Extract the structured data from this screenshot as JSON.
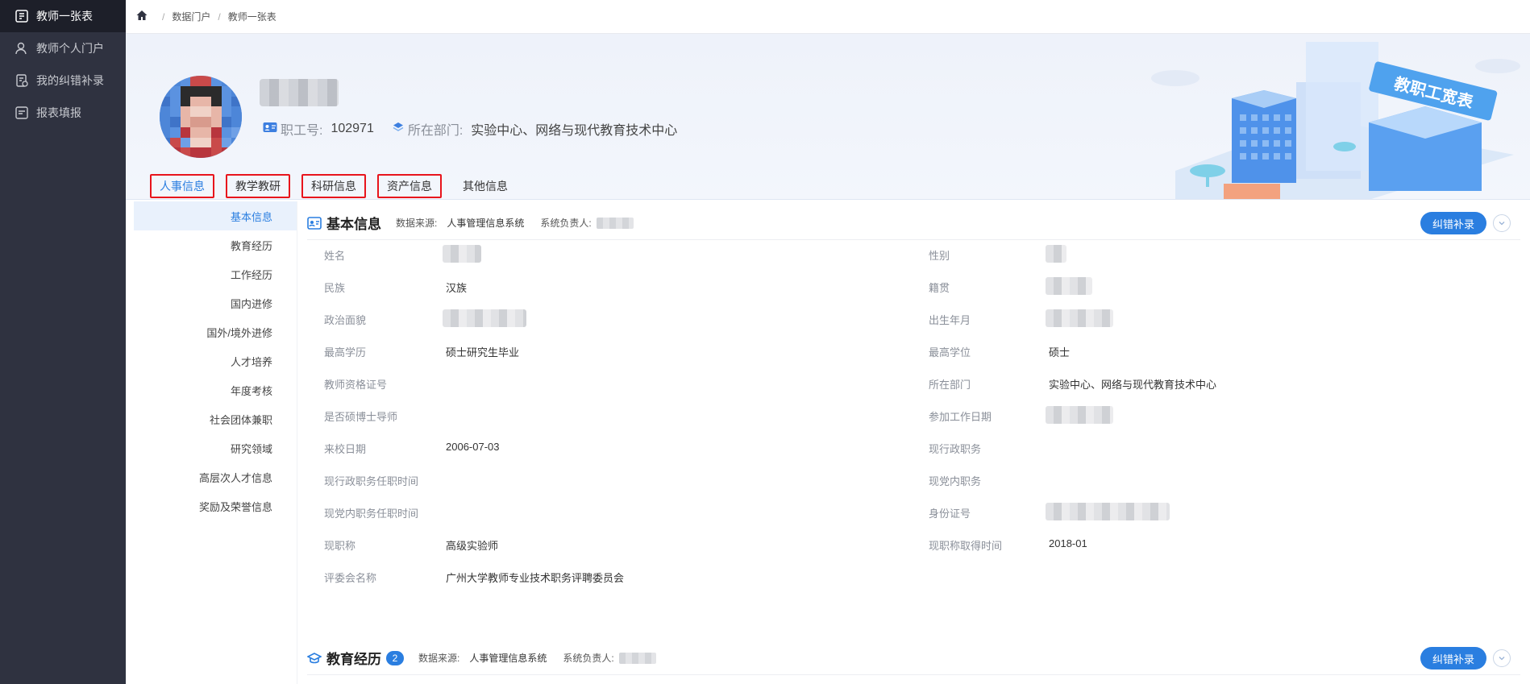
{
  "sidebar": {
    "items": [
      {
        "label": "教师一张表",
        "icon": "table-icon",
        "active": true
      },
      {
        "label": "教师个人门户",
        "icon": "user-icon",
        "active": false
      },
      {
        "label": "我的纠错补录",
        "icon": "edit-file-icon",
        "active": false
      },
      {
        "label": "报表填报",
        "icon": "report-icon",
        "active": false
      }
    ]
  },
  "breadcrumb": {
    "items": [
      "数据门户",
      "教师一张表"
    ],
    "separator": "/"
  },
  "profile": {
    "employee_id_label": "职工号:",
    "employee_id": "102971",
    "dept_label": "所在部门:",
    "dept": "实验中心、网络与现代教育技术中心",
    "banner_badge": "教职工宽表"
  },
  "tabs": [
    {
      "label": "人事信息",
      "active": true,
      "highlighted": true
    },
    {
      "label": "教学教研",
      "active": false,
      "highlighted": true
    },
    {
      "label": "科研信息",
      "active": false,
      "highlighted": true
    },
    {
      "label": "资产信息",
      "active": false,
      "highlighted": true
    },
    {
      "label": "其他信息",
      "active": false,
      "highlighted": false
    }
  ],
  "subnav": [
    "基本信息",
    "教育经历",
    "工作经历",
    "国内进修",
    "国外/境外进修",
    "人才培养",
    "年度考核",
    "社会团体兼职",
    "研究领域",
    "高层次人才信息",
    "奖励及荣誉信息"
  ],
  "basic_info": {
    "title": "基本信息",
    "source_label": "数据来源:",
    "source": "人事管理信息系统",
    "owner_label": "系统负责人:",
    "fix_button": "纠错补录",
    "left_fields": [
      {
        "label": "姓名",
        "value": ""
      },
      {
        "label": "民族",
        "value": "汉族"
      },
      {
        "label": "政治面貌",
        "value": ""
      },
      {
        "label": "最高学历",
        "value": "硕士研究生毕业"
      },
      {
        "label": "教师资格证号",
        "value": ""
      },
      {
        "label": "是否硕博士导师",
        "value": ""
      },
      {
        "label": "来校日期",
        "value": "2006-07-03"
      },
      {
        "label": "现行政职务任职时间",
        "value": ""
      },
      {
        "label": "现党内职务任职时间",
        "value": ""
      },
      {
        "label": "现职称",
        "value": "高级实验师"
      },
      {
        "label": "评委会名称",
        "value": "广州大学教师专业技术职务评聘委员会"
      }
    ],
    "right_fields": [
      {
        "label": "性别",
        "value": ""
      },
      {
        "label": "籍贯",
        "value": ""
      },
      {
        "label": "出生年月",
        "value": ""
      },
      {
        "label": "最高学位",
        "value": "硕士"
      },
      {
        "label": "所在部门",
        "value": "实验中心、网络与现代教育技术中心"
      },
      {
        "label": "参加工作日期",
        "value": ""
      },
      {
        "label": "现行政职务",
        "value": ""
      },
      {
        "label": "现党内职务",
        "value": ""
      },
      {
        "label": "身份证号",
        "value": ""
      },
      {
        "label": "现职称取得时间",
        "value": "2018-01"
      }
    ]
  },
  "education": {
    "title": "教育经历",
    "count": "2",
    "source_label": "数据来源:",
    "source": "人事管理信息系统",
    "owner_label": "系统负责人:",
    "fix_button": "纠错补录"
  }
}
